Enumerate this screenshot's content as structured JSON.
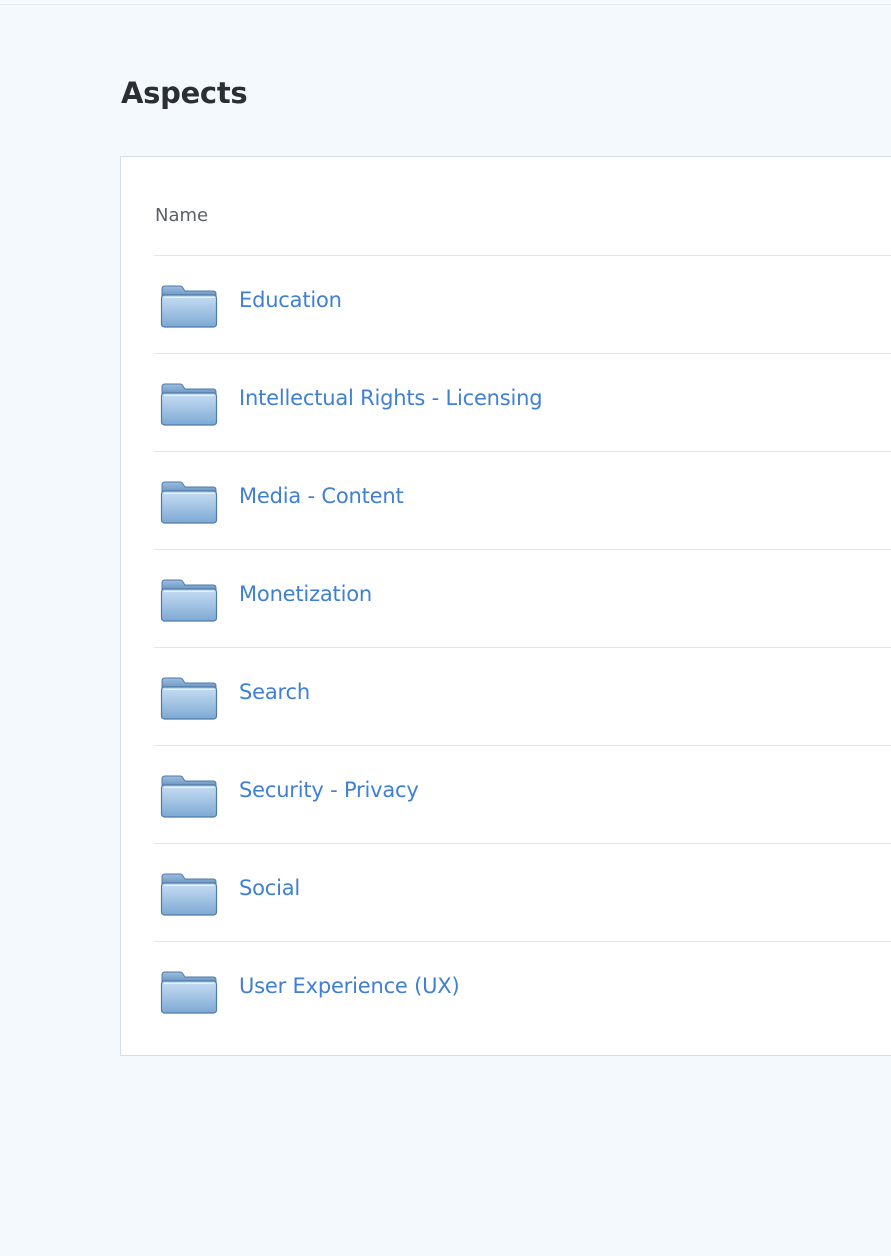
{
  "page": {
    "title": "Aspects",
    "background_color": "#f4f9fe"
  },
  "table": {
    "column_header": "Name",
    "link_color": "#3f7fd4",
    "folder_icon": "folder-icon",
    "rows": [
      {
        "label": "Education"
      },
      {
        "label": "Intellectual Rights - Licensing"
      },
      {
        "label": "Media - Content"
      },
      {
        "label": "Monetization"
      },
      {
        "label": "Search"
      },
      {
        "label": "Security - Privacy"
      },
      {
        "label": "Social"
      },
      {
        "label": "User Experience (UX)"
      }
    ]
  }
}
